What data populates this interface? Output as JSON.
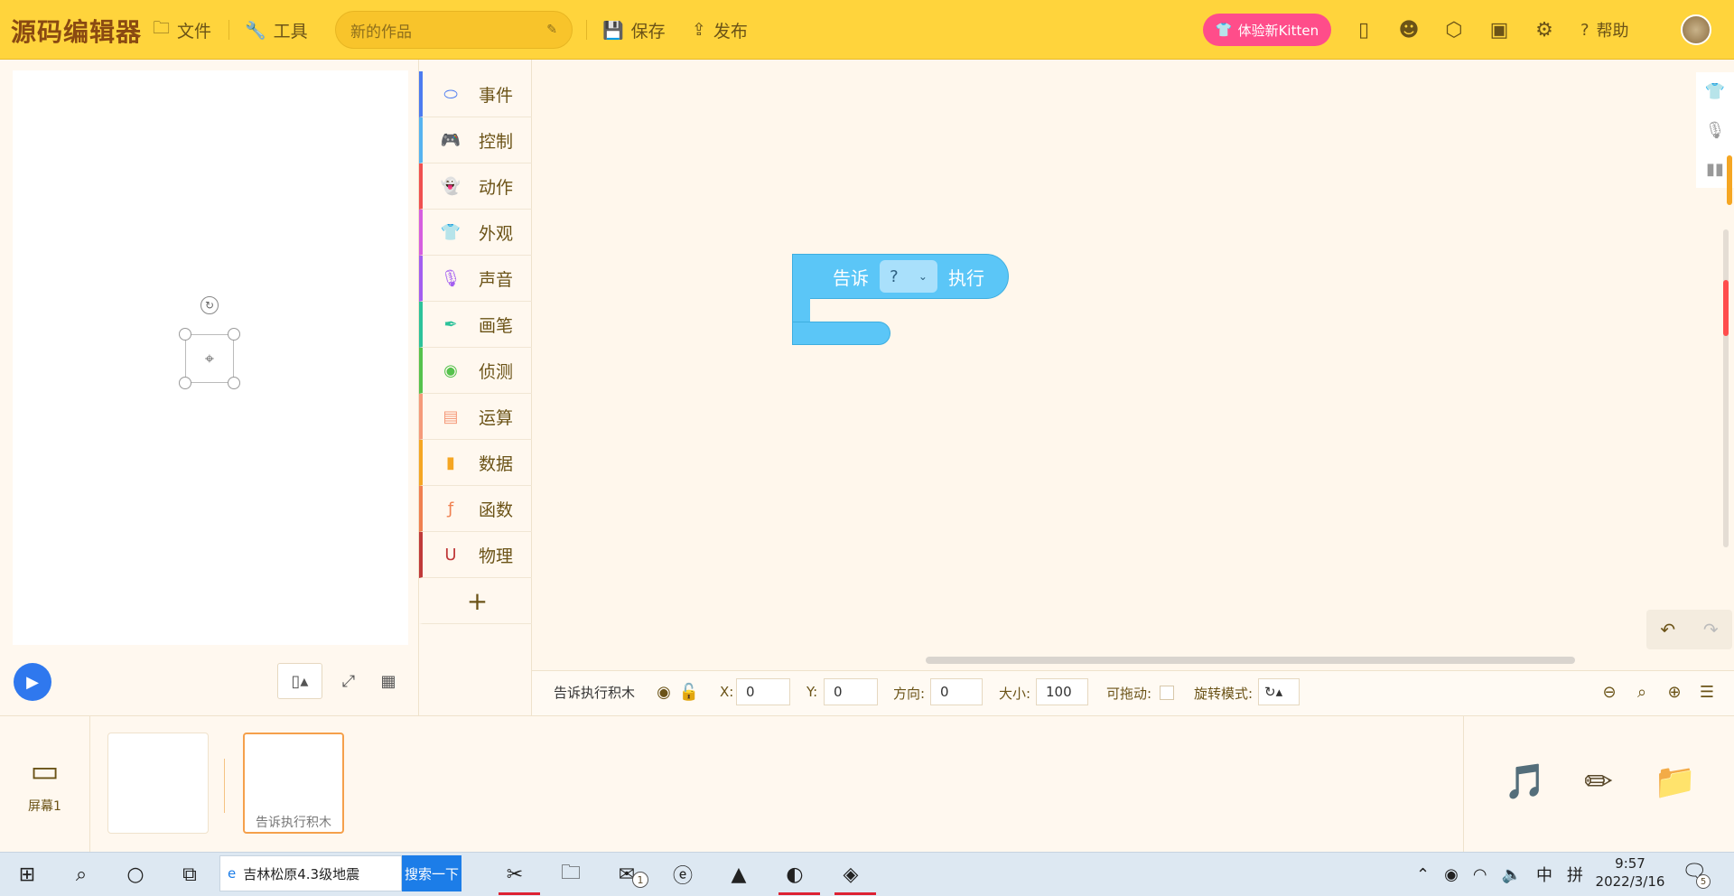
{
  "app": {
    "logo": "源码编辑器",
    "menu": {
      "file": "文件",
      "tools": "工具",
      "save": "保存",
      "publish": "发布",
      "help": "帮助"
    },
    "project_name": "新的作品",
    "kitten_button": "体验新Kitten"
  },
  "categories": [
    {
      "label": "事件",
      "color": "#4c7bf0",
      "icon": "toggle-icon"
    },
    {
      "label": "控制",
      "color": "#56b3f0",
      "icon": "gamepad-icon"
    },
    {
      "label": "动作",
      "color": "#f05050",
      "icon": "ghost-icon"
    },
    {
      "label": "外观",
      "color": "#d65ee0",
      "icon": "shirt-icon"
    },
    {
      "label": "声音",
      "color": "#a35ef0",
      "icon": "microphone-icon"
    },
    {
      "label": "画笔",
      "color": "#2cc29a",
      "icon": "pen-icon"
    },
    {
      "label": "侦测",
      "color": "#55c24d",
      "icon": "radar-icon"
    },
    {
      "label": "运算",
      "color": "#f59a7a",
      "icon": "calculator-icon"
    },
    {
      "label": "数据",
      "color": "#f5a623",
      "icon": "bar-chart-icon"
    },
    {
      "label": "函数",
      "color": "#f08050",
      "icon": "function-icon"
    },
    {
      "label": "物理",
      "color": "#c03a3a",
      "icon": "magnet-icon"
    }
  ],
  "add_category": "+",
  "block": {
    "prefix": "告诉",
    "dropdown": "?",
    "suffix": "执行"
  },
  "properties": {
    "name": "告诉执行积木",
    "x_label": "X:",
    "x": "0",
    "y_label": "Y:",
    "y": "0",
    "direction_label": "方向:",
    "direction": "0",
    "size_label": "大小:",
    "size": "100",
    "draggable_label": "可拖动:",
    "rotation_label": "旋转模式:"
  },
  "screen": {
    "label": "屏幕1"
  },
  "sprites": [
    {
      "label": ""
    },
    {
      "label": "告诉执行积木"
    }
  ],
  "taskbar": {
    "search_text": "吉林松原4.3级地震",
    "search_button": "搜索一下",
    "ime_lang": "中",
    "ime_mode": "拼",
    "time": "9:57",
    "date": "2022/3/16",
    "notifications": "5",
    "mail_badge": "1"
  }
}
